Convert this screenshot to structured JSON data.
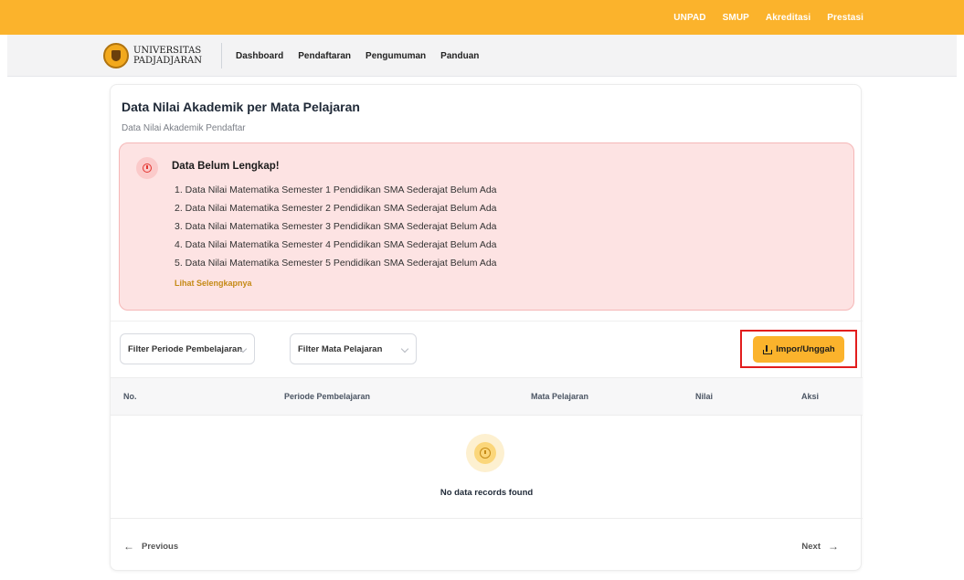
{
  "topbar": {
    "links": [
      "UNPAD",
      "SMUP",
      "Akreditasi",
      "Prestasi"
    ],
    "color": "#fbb32c"
  },
  "brand": {
    "line1": "UNIVERSITAS",
    "line2": "PADJADJARAN"
  },
  "nav": {
    "items": [
      "Dashboard",
      "Pendaftaran",
      "Pengumuman",
      "Panduan"
    ]
  },
  "page": {
    "title": "Data Nilai Akademik per Mata Pelajaran",
    "subtitle": "Data Nilai Akademik Pendaftar"
  },
  "alert": {
    "icon": "alert-circle-icon",
    "title": "Data Belum Lengkap!",
    "items": [
      "1. Data Nilai Matematika Semester 1 Pendidikan SMA Sederajat Belum Ada",
      "2. Data Nilai Matematika Semester 2 Pendidikan SMA Sederajat Belum Ada",
      "3. Data Nilai Matematika Semester 3 Pendidikan SMA Sederajat Belum Ada",
      "4. Data Nilai Matematika Semester 4 Pendidikan SMA Sederajat Belum Ada",
      "5. Data Nilai Matematika Semester 5 Pendidikan SMA Sederajat Belum Ada"
    ],
    "more_link": "Lihat Selengkapnya"
  },
  "filters": {
    "period": "Filter Periode Pembelajaran",
    "subject": "Filter Mata Pelajaran"
  },
  "actions": {
    "upload": "Impor/Unggah"
  },
  "table": {
    "columns": [
      "No.",
      "Periode Pembelajaran",
      "Mata Pelajaran",
      "Nilai",
      "Aksi"
    ],
    "empty_text": "No data records found"
  },
  "pagination": {
    "previous": "Previous",
    "next": "Next"
  }
}
